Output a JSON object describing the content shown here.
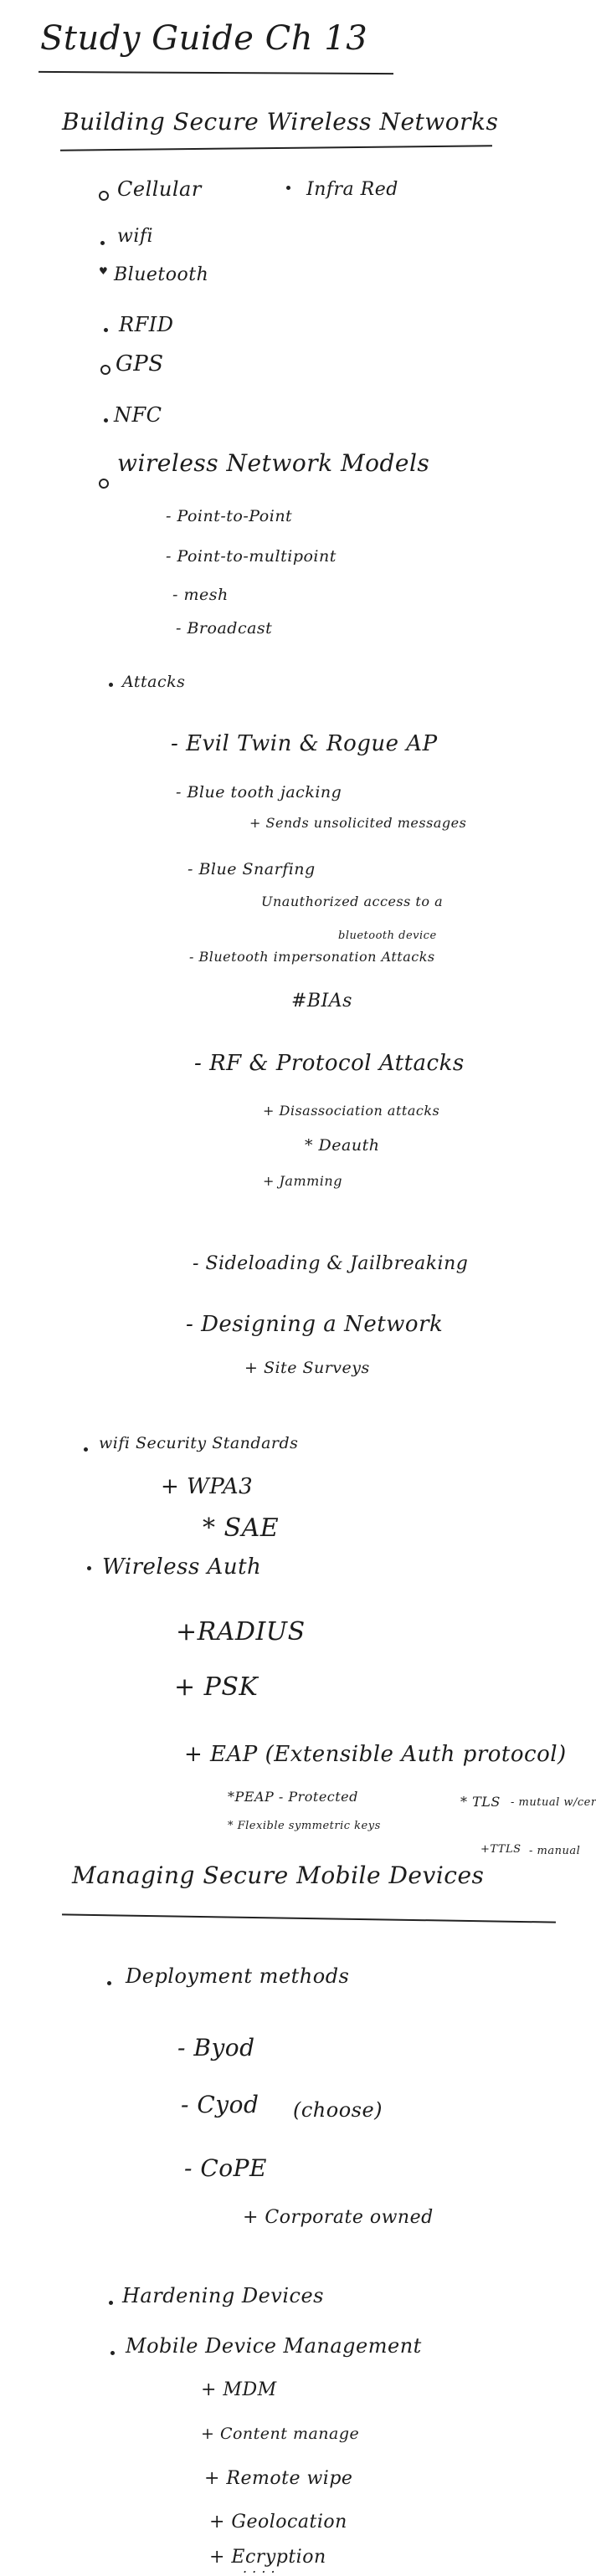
{
  "title": "Study Guide Ch 13",
  "section1": {
    "heading": "Building Secure Wireless Networks",
    "connection_types": [
      "Cellular",
      "Infra Red",
      "wifi",
      "Bluetooth",
      "RFID",
      "GPS",
      "NFC"
    ],
    "models": {
      "label": "wireless Network Models",
      "items": [
        "Point-to-Point",
        "Point-to-multipoint",
        "mesh",
        "Broadcast"
      ]
    },
    "attacks": {
      "label": "Attacks",
      "evil_twin": "Evil Twin & Rogue AP",
      "bluejacking": "Blue tooth jacking",
      "bluejacking_note": "+ Sends unsolicited messages",
      "bluesnarfing": "Blue Snarfing",
      "bluesnarfing_note_1": "Unauthorized access to a",
      "bluesnarfing_note_2": "bluetooth device",
      "bt_impersonation": "Bluetooth impersonation Attacks",
      "bt_impersonation_note": "#BIAs",
      "rf_protocol": "RF & Protocol Attacks",
      "disassoc": "+ Disassociation attacks",
      "deauth": "* Deauth",
      "jamming": "+ Jamming",
      "sideloading": "Sideloading & Jailbreaking",
      "designing": "Designing a Network",
      "site_surveys": "+ Site Surveys"
    },
    "security_standards": {
      "label": "wifi Security Standards",
      "wpa3": "+ WPA3",
      "sae": "* SAE"
    },
    "wireless_auth": {
      "label": "Wireless Auth",
      "radius": "+RADIUS",
      "psk": "+ PSK",
      "eap": "+ EAP (Extensible Auth protocol)",
      "peap": "*PEAP - Protected",
      "flexible": "* Flexible  symmetric keys",
      "tls": "* TLS",
      "tls_note": "- mutual w/cert",
      "ttls": "+TTLS",
      "ttls_note": "- manual"
    }
  },
  "section2": {
    "heading": "Managing Secure Mobile Devices",
    "deployment": {
      "label": "Deployment methods",
      "byod": "- Byod",
      "cyod": "- Cyod",
      "cyod_note": "(choose)",
      "cope": "- CoPE",
      "cope_note": "+ Corporate owned"
    },
    "hardening": "Hardening Devices",
    "mdm": {
      "label": "Mobile Device Management",
      "items": [
        "+ MDM",
        "+ Content manage",
        "+ Remote wipe",
        "+ Geolocation",
        "+ Ecryption"
      ],
      "more": ". . . ."
    }
  },
  "colors": {
    "ink": "#1c1c1c",
    "paper": "#ffffff"
  }
}
